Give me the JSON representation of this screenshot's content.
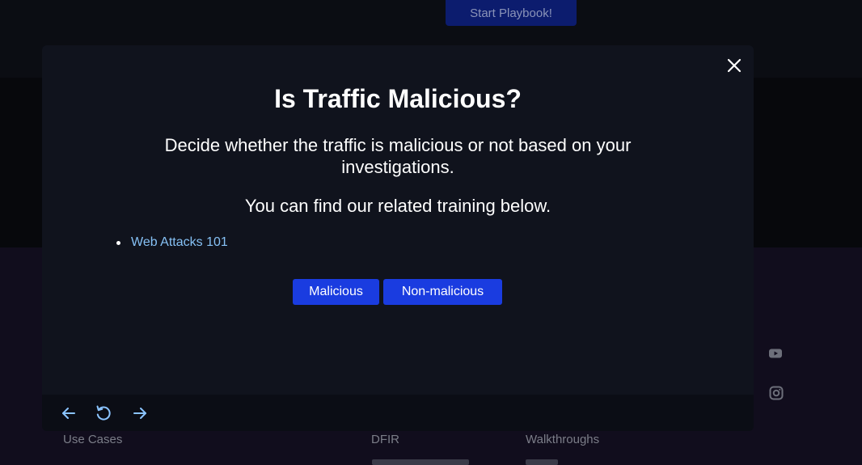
{
  "background": {
    "start_button": "Start Playbook!",
    "footer_links": [
      "Use Cases",
      "DFIR",
      "Walkthroughs"
    ],
    "social_icons": [
      "youtube-icon",
      "instagram-icon"
    ]
  },
  "modal": {
    "title": "Is Traffic Malicious?",
    "description": "Decide whether the traffic is malicious or not based on your investigations.",
    "training_prompt": "You can find our related training below.",
    "training_links": [
      "Web Attacks 101"
    ],
    "buttons": {
      "malicious": "Malicious",
      "non_malicious": "Non-malicious"
    },
    "close_icon": "close-icon",
    "nav": [
      "arrow-left-icon",
      "refresh-icon",
      "arrow-right-icon"
    ]
  },
  "colors": {
    "accent": "#1a3ce0",
    "link": "#86c1f5",
    "modal_bg": "#10131d"
  }
}
